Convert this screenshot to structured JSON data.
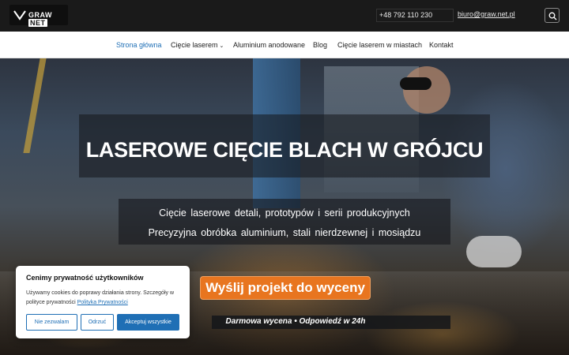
{
  "header": {
    "logo": {
      "text_main": "GRAW",
      "text_accent": "NET"
    },
    "phone": "+48 792 110 230",
    "email": "biuro@graw.net.pl",
    "search_icon": "search-icon"
  },
  "nav": {
    "items": [
      {
        "label": "Strona główna",
        "active": true
      },
      {
        "label": "Cięcie laserem",
        "dropdown": true
      },
      {
        "label": "Aluminium anodowane"
      },
      {
        "label": "Blog"
      },
      {
        "label": "Cięcie laserem w miastach"
      },
      {
        "label": "Kontakt"
      }
    ],
    "chevron_glyph": "⌄"
  },
  "hero": {
    "title": "LASEROWE CIĘCIE BLACH W GRÓJCU",
    "subtitle_line1": "Cięcie laserowe detali, prototypów i serii produkcyjnych",
    "subtitle_line2": "Precyzyjna obróbka aluminium, stali nierdzewnej i mosiądzu",
    "cta_label": "Wyślij projekt do wyceny",
    "note": "Darmowa wycena • Odpowiedź w 24h"
  },
  "cookie": {
    "title": "Cenimy prywatność użytkowników",
    "text": "Używamy cookies do poprawy działania strony. Szczegóły w polityce prywatności",
    "link": "Polityka Prywatności",
    "buttons": {
      "deny": "Nie zezwalam",
      "reject": "Odrzuć",
      "accept": "Akceptuj wszystkie"
    }
  },
  "colors": {
    "accent": "#1f6fb5",
    "cta": "#e8751f",
    "topbar": "#1a1a1a"
  }
}
